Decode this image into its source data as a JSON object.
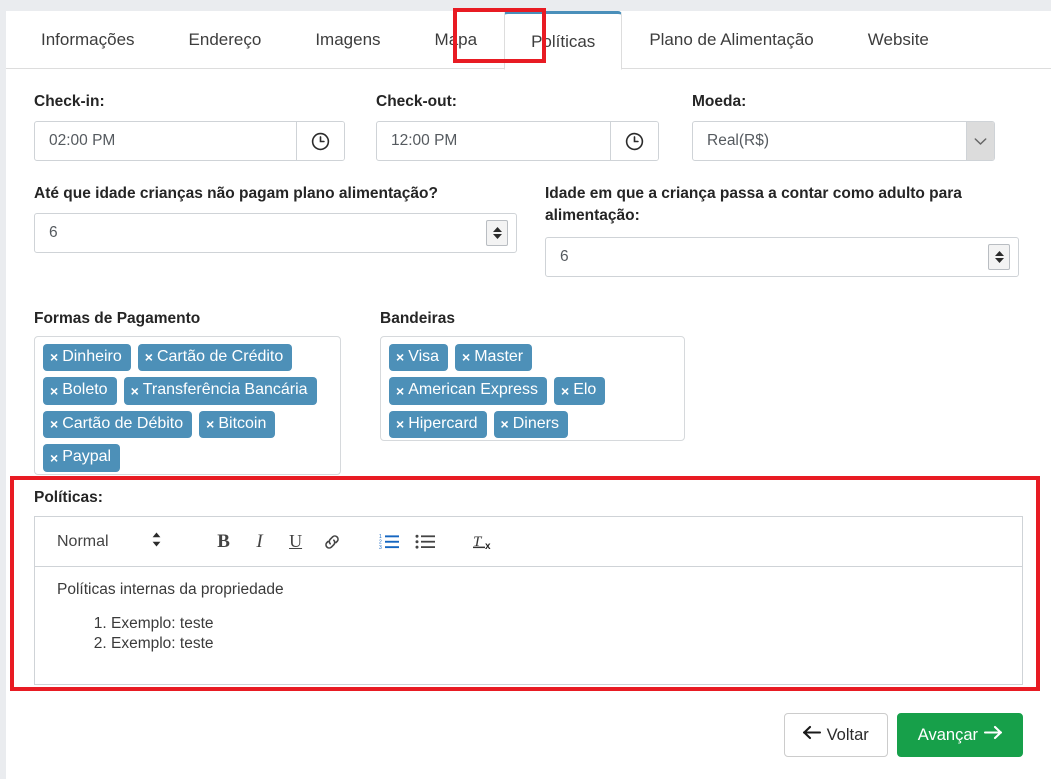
{
  "tabs": [
    {
      "label": "Informações",
      "active": false
    },
    {
      "label": "Endereço",
      "active": false
    },
    {
      "label": "Imagens",
      "active": false
    },
    {
      "label": "Mapa",
      "active": false
    },
    {
      "label": "Políticas",
      "active": true
    },
    {
      "label": "Plano de Alimentação",
      "active": false
    },
    {
      "label": "Website",
      "active": false
    }
  ],
  "fields": {
    "checkin": {
      "label": "Check-in:",
      "value": "02:00 PM",
      "icon": "clock-icon"
    },
    "checkout": {
      "label": "Check-out:",
      "value": "12:00 PM",
      "icon": "clock-icon"
    },
    "currency": {
      "label": "Moeda:",
      "value": "Real(R$)",
      "icon": "chevron-down-icon"
    },
    "children_free_age": {
      "label": "Até que idade crianças não pagam plano alimentação?",
      "value": "6"
    },
    "child_adult_age": {
      "label": "Idade em que a criança passa a contar como adulto para alimentação:",
      "value": "6"
    }
  },
  "payment_methods": {
    "label": "Formas de Pagamento",
    "tags": [
      "Dinheiro",
      "Cartão de Crédito",
      "Boleto",
      "Transferência Bancária",
      "Cartão de Débito",
      "Bitcoin",
      "Paypal"
    ]
  },
  "card_brands": {
    "label": "Bandeiras",
    "tags": [
      "Visa",
      "Master",
      "American Express",
      "Elo",
      "Hipercard",
      "Diners"
    ]
  },
  "policies": {
    "label": "Políticas:",
    "toolbar": {
      "format": "Normal",
      "bold": "B",
      "italic": "I",
      "underline": "U",
      "link": "link-icon",
      "ordered_list": "ordered-list-icon",
      "bullet_list": "bullet-list-icon",
      "clear_format": "clear-format-icon"
    },
    "body": {
      "paragraph": "Políticas internas da propriedade",
      "list": [
        "Exemplo: teste",
        "Exemplo: teste"
      ]
    }
  },
  "footer": {
    "back_label": "Voltar",
    "next_label": "Avançar"
  },
  "colors": {
    "tag": "#4d90b8",
    "primary_green": "#17a04a",
    "annotation_red": "#e81b23",
    "active_tab_border": "#4a8fba"
  }
}
